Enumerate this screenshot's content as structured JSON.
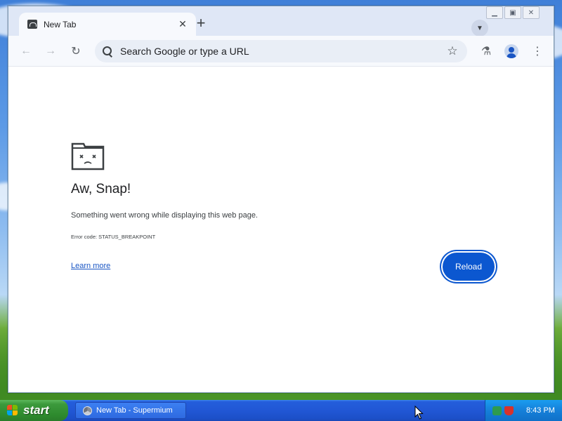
{
  "browser": {
    "tab": {
      "title": "New Tab",
      "close_icon": "close-icon"
    },
    "new_tab_icon": "plus-icon",
    "tab_search_icon": "chevron-down-icon",
    "window_controls": {
      "minimize": "minimize-icon",
      "maximize": "maximize-icon",
      "close": "close-icon"
    },
    "toolbar": {
      "back_icon": "arrow-left-icon",
      "forward_icon": "arrow-right-icon",
      "reload_icon": "reload-icon",
      "omnibox_placeholder": "Search Google or type a URL",
      "bookmark_icon": "star-icon",
      "labs_icon": "flask-icon",
      "profile_icon": "avatar-icon",
      "menu_icon": "kebab-menu-icon"
    }
  },
  "error_page": {
    "icon": "sad-folder-icon",
    "title": "Aw, Snap!",
    "message": "Something went wrong while displaying this web page.",
    "error_code": "Error code: STATUS_BREAKPOINT",
    "learn_more": "Learn more",
    "reload_button": "Reload"
  },
  "taskbar": {
    "start_label": "start",
    "task_item": "New Tab - Supermium",
    "clock": "8:43 PM"
  },
  "colors": {
    "accent": "#0b57d0",
    "link": "#1a56c4",
    "tabstrip": "#dfe7f6",
    "taskbar": "#2157d5",
    "start_green": "#3c9a3c"
  }
}
